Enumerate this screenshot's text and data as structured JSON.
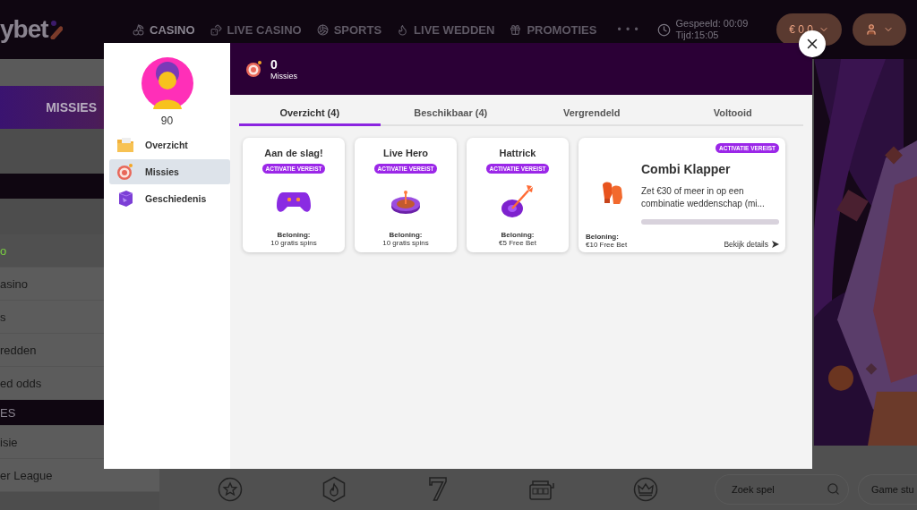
{
  "header": {
    "logo": "ybet",
    "nav": [
      {
        "kind": "cherry",
        "label": "CASINO",
        "selected": true
      },
      {
        "kind": "dice",
        "label": "LIVE CASINO",
        "selected": false
      },
      {
        "kind": "ball",
        "label": "SPORTS",
        "selected": false
      },
      {
        "kind": "flame",
        "label": "LIVE WEDDEN",
        "selected": false
      },
      {
        "kind": "gift",
        "label": "PROMOTIES",
        "selected": false
      }
    ],
    "more": "• • •",
    "played": "Gespeeld:  00:09",
    "time": "Tijd:15:05",
    "balance": "€ 0,0"
  },
  "sidebar": {
    "banner": "MISSIES",
    "items": [
      {
        "kind": "item",
        "label": "o",
        "selected": true
      },
      {
        "kind": "item",
        "label": "asino",
        "selected": false
      },
      {
        "kind": "item",
        "label": "s",
        "selected": false
      },
      {
        "kind": "item",
        "label": "redden",
        "selected": false
      },
      {
        "kind": "item",
        "label": "ed odds",
        "selected": false
      },
      {
        "kind": "heading",
        "label": "ES"
      },
      {
        "kind": "item",
        "label": "isie",
        "selected": false
      },
      {
        "kind": "item",
        "label": "er League",
        "selected": false
      }
    ]
  },
  "bottom_bar": {
    "icons": [
      {
        "kind": "star"
      },
      {
        "kind": "flame"
      },
      {
        "kind": "glyph",
        "glyph": "7"
      },
      {
        "kind": "slot"
      },
      {
        "kind": "crown"
      }
    ],
    "search": {
      "placeholder": "Zoek spel"
    },
    "button": "Game stu"
  },
  "modal": {
    "level": "90",
    "menu": [
      {
        "kind": "folder",
        "label": "Overzicht",
        "selected": false
      },
      {
        "kind": "target",
        "label": "Missies",
        "selected": true
      },
      {
        "kind": "cube",
        "label": "Geschiedenis",
        "selected": false
      }
    ],
    "count": "0",
    "count_label": "Missies",
    "tabs": [
      {
        "label": "Overzicht (4)",
        "selected": true
      },
      {
        "label": "Beschikbaar (4)",
        "selected": false
      },
      {
        "label": "Vergrendeld",
        "selected": false
      },
      {
        "label": "Voltooid",
        "selected": false
      }
    ],
    "missions": [
      {
        "kind": "compact",
        "title": "Aan de slag!",
        "badge": "ACTIVATIE VEREIST",
        "reward_label": "Beloning:",
        "reward": "10 gratis spins"
      },
      {
        "kind": "compact",
        "title": "Live Hero",
        "badge": "ACTIVATIE VEREIST",
        "reward_label": "Beloning:",
        "reward": "10 gratis spins"
      },
      {
        "kind": "compact",
        "title": "Hattrick",
        "badge": "ACTIVATIE VEREIST",
        "reward_label": "Beloning:",
        "reward": "€5 Free Bet"
      },
      {
        "kind": "wide",
        "title": "Combi Klapper",
        "badge": "ACTIVATIE VEREIST",
        "description": "Zet €30 of meer in op een combinatie weddenschap (mi...",
        "level": 0,
        "reward_label": "Beloning:",
        "reward": "€10 Free Bet",
        "link": "Bekijk details"
      }
    ]
  }
}
